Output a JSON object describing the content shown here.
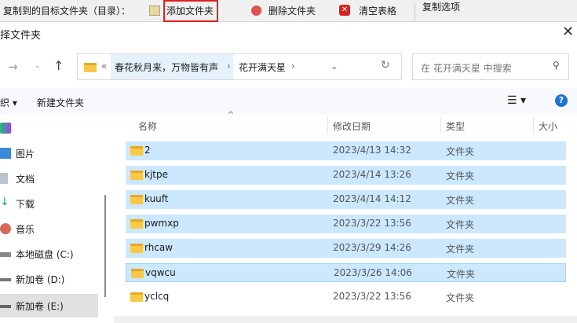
{
  "toolbar": {
    "target_label": "复制到的目标文件夹（目录）：",
    "add_folder": "添加文件夹",
    "delete_folder": "删除文件夹",
    "clear_table": "清空表格",
    "copy_options": "复制选项"
  },
  "dialog": {
    "title": "择文件夹",
    "breadcrumb": [
      "春花秋月来，万物皆有声",
      "花开满天星"
    ],
    "search_placeholder": "在 花开满天星 中搜索",
    "organize": "织 ▾",
    "new_folder": "新建文件夹"
  },
  "nav": [
    {
      "label": "",
      "icon": "app-logo-icon"
    },
    {
      "label": "图片",
      "icon": "pictures-icon"
    },
    {
      "label": "文档",
      "icon": "documents-icon"
    },
    {
      "label": "下载",
      "icon": "download-icon"
    },
    {
      "label": "音乐",
      "icon": "music-icon"
    },
    {
      "label": "本地磁盘 (C:)",
      "icon": "drive-icon"
    },
    {
      "label": "新加卷 (D:)",
      "icon": "drive-icon"
    },
    {
      "label": "新加卷 (E:)",
      "icon": "drive-icon"
    }
  ],
  "columns": {
    "name": "名称",
    "date": "修改日期",
    "type": "类型",
    "size": "大小"
  },
  "files": [
    {
      "name": "2",
      "date": "2023/4/13 14:32",
      "type": "文件夹",
      "selected": true
    },
    {
      "name": "kjtpe",
      "date": "2023/4/14 13:26",
      "type": "文件夹",
      "selected": true
    },
    {
      "name": "kuuft",
      "date": "2023/4/14 14:12",
      "type": "文件夹",
      "selected": true
    },
    {
      "name": "pwmxp",
      "date": "2023/3/22 13:56",
      "type": "文件夹",
      "selected": true
    },
    {
      "name": "rhcaw",
      "date": "2023/3/29 14:26",
      "type": "文件夹",
      "selected": true
    },
    {
      "name": "vqwcu",
      "date": "2023/3/26 14:06",
      "type": "文件夹",
      "selected": true
    },
    {
      "name": "yclcq",
      "date": "2023/3/22 13:56",
      "type": "文件夹",
      "selected": false
    }
  ]
}
